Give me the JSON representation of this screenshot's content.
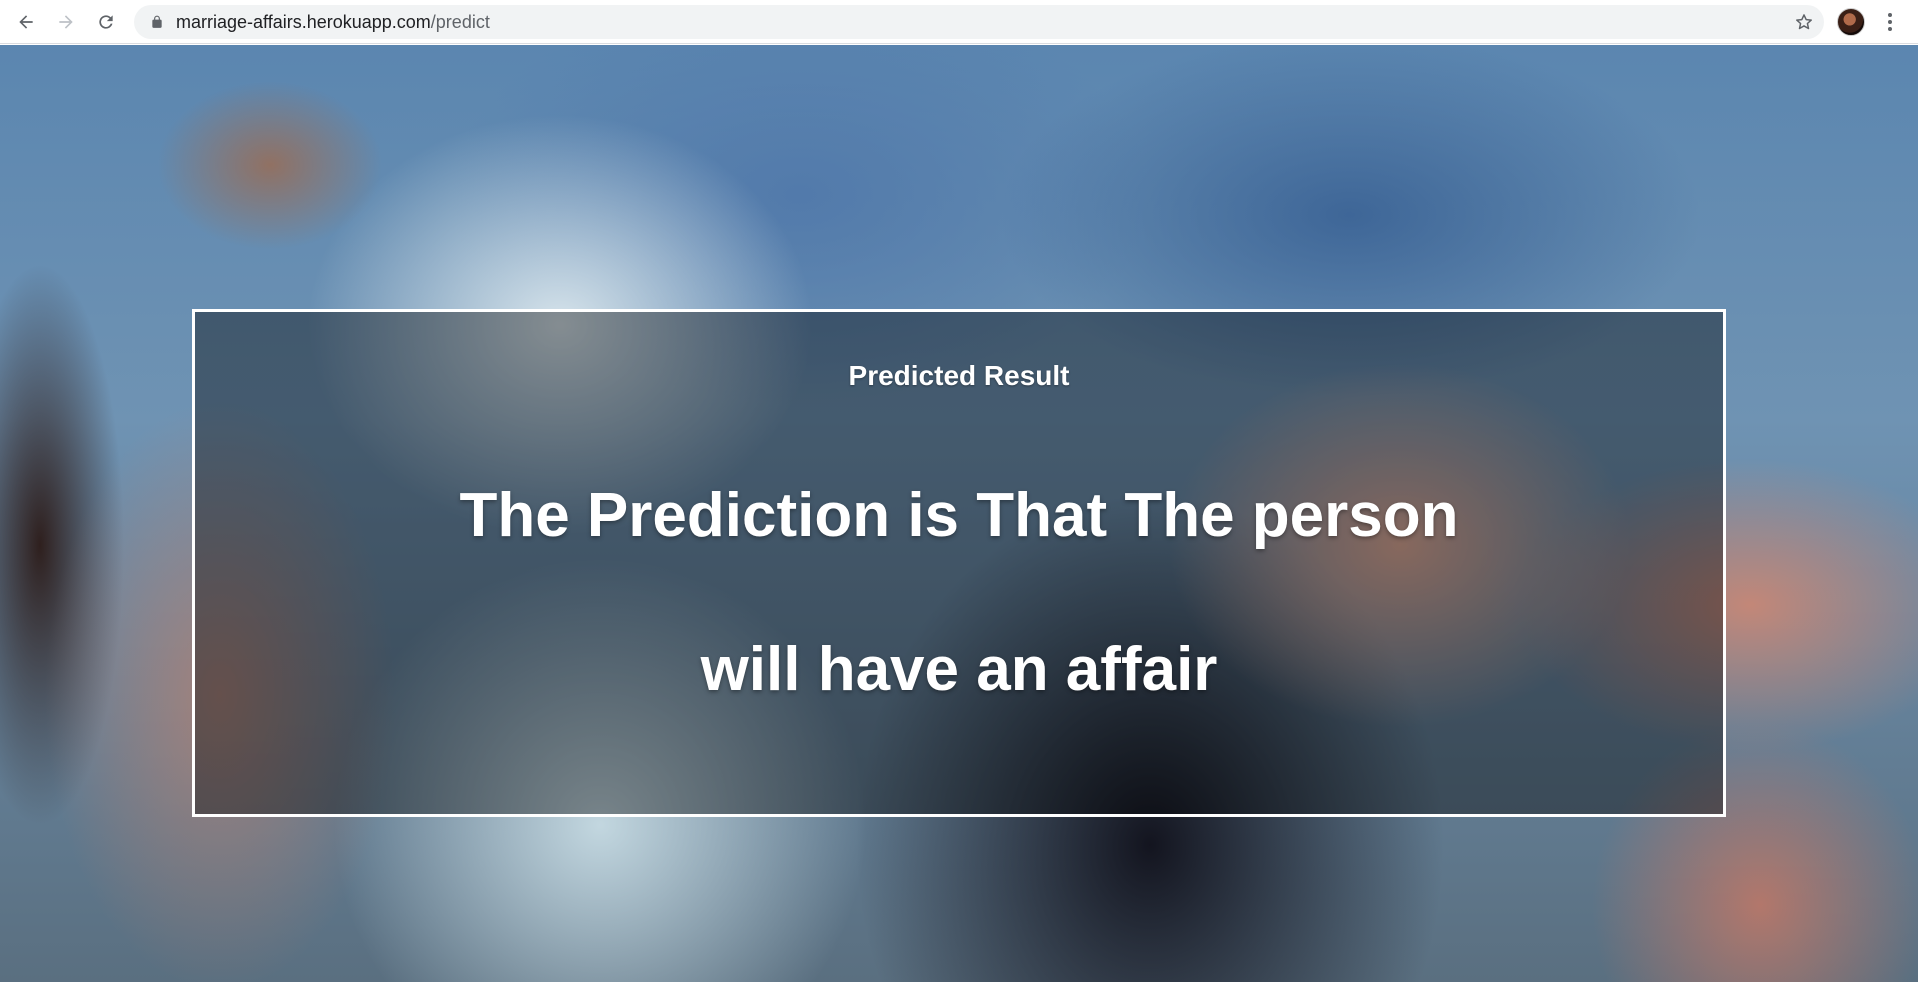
{
  "browser": {
    "url_host": "marriage-affairs.herokuapp.com",
    "url_path": "/predict",
    "icons": {
      "back": "arrow-left-icon",
      "forward": "arrow-right-icon",
      "reload": "reload-icon",
      "lock": "lock-icon",
      "bookmark": "star-icon",
      "menu": "kebab-menu-icon"
    }
  },
  "result": {
    "heading": "Predicted Result",
    "line1": "The Prediction is That The person",
    "line2": "will have an affair"
  },
  "colors": {
    "panel_border": "#ffffff",
    "text": "#ffffff"
  }
}
